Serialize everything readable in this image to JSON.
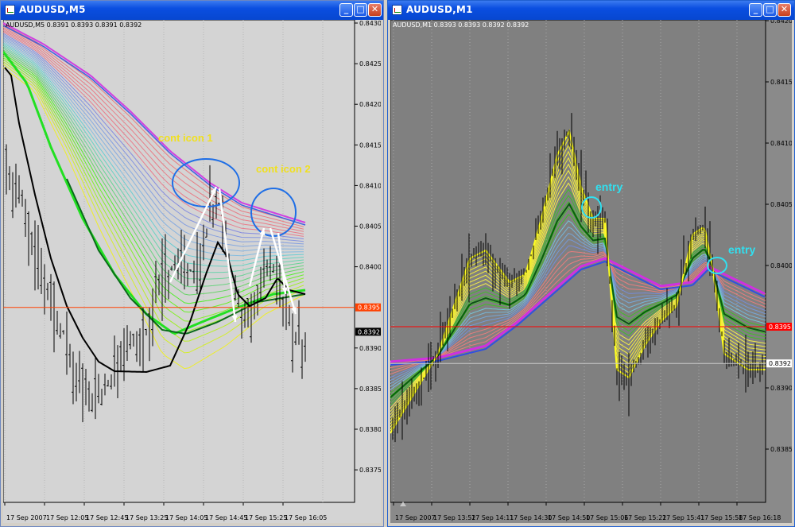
{
  "windows": [
    {
      "id": "left",
      "title": "AUDUSD,M5",
      "header": "AUDUSD,M5  0.8391 0.8393 0.8391 0.8392",
      "buttons": {
        "minimize": "_",
        "maximize": "□",
        "close": "✕"
      },
      "y_ticks": [
        "0.8430",
        "0.8425",
        "0.8420",
        "0.8415",
        "0.8410",
        "0.8405",
        "0.8400",
        "0.8395",
        "0.8392",
        "0.8390",
        "0.8385",
        "0.8380",
        "0.8375"
      ],
      "x_ticks": [
        "17 Sep 2007",
        "17 Sep 12:05",
        "17 Sep 12:45",
        "17 Sep 13:25",
        "17 Sep 14:05",
        "17 Sep 14:45",
        "17 Sep 15:25",
        "17 Sep 16:05"
      ],
      "price_marker_red": "0.8395",
      "price_marker_current": "0.8392",
      "annotations": [
        "cont icon 1",
        "cont icon 2"
      ],
      "colors": {
        "background": "#d4d4d4",
        "red_line": "#ff4000",
        "annotation_text": "#f0e020",
        "circle": "#1e6ee6"
      }
    },
    {
      "id": "right",
      "title": "AUDUSD,M1",
      "header": "AUDUSD,M1  0.8393 0.8393 0.8392 0.8392",
      "buttons": {
        "minimize": "_",
        "maximize": "□",
        "close": "✕"
      },
      "y_ticks": [
        "0.8420",
        "0.8415",
        "0.8410",
        "0.8405",
        "0.8400",
        "0.8395",
        "0.8392",
        "0.8390",
        "0.8385"
      ],
      "x_ticks": [
        "17 Sep 2007",
        "17 Sep 13:52",
        "17 Sep 14:11",
        "17 Sep 14:30",
        "17 Sep 14:50",
        "17 Sep 15:06",
        "17 Sep 15:22",
        "17 Sep 15:41",
        "17 Sep 15:58",
        "17 Sep 16:18"
      ],
      "price_marker_red": "0.8395",
      "price_marker_current": "0.8392",
      "annotations": [
        "entry",
        "entry"
      ],
      "colors": {
        "background": "#808080",
        "red_line": "#ff0000",
        "annotation_text": "#30e0f0",
        "circle": "#30e0f0"
      }
    }
  ]
}
